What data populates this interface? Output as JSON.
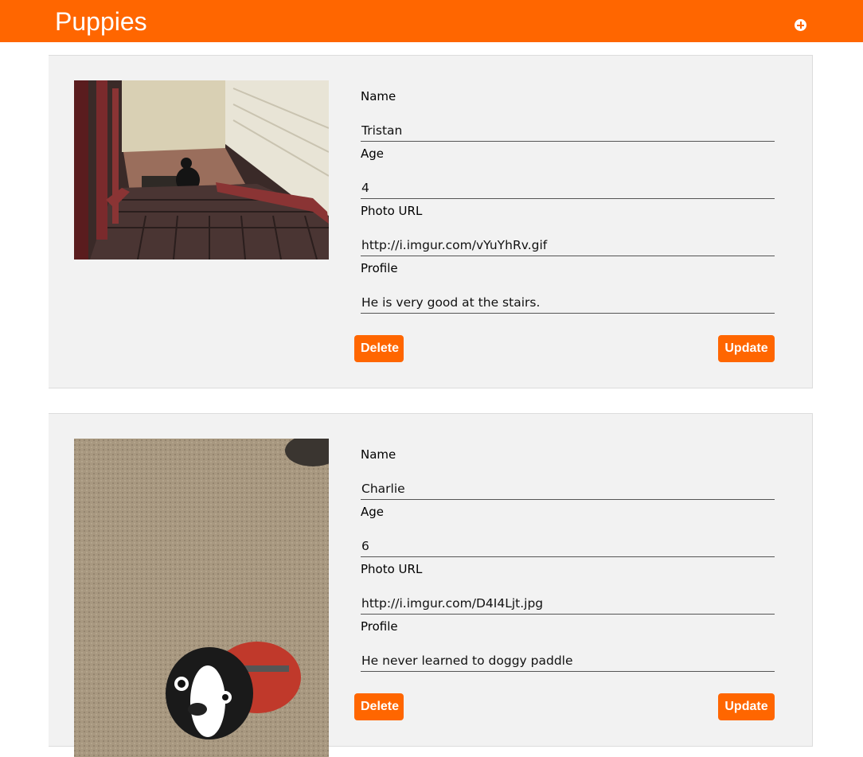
{
  "header": {
    "title": "Puppies",
    "add_icon": "plus-circle-icon"
  },
  "colors": {
    "accent": "#ff6600",
    "card_bg": "#f2f2f2"
  },
  "puppies": [
    {
      "name_label": "Name",
      "name": "Tristan",
      "age_label": "Age",
      "age": "4",
      "photo_label": "Photo URL",
      "photo_url": "http://i.imgur.com/vYuYhRv.gif",
      "profile_label": "Profile",
      "profile": "He is very good at the stairs.",
      "delete_label": "Delete",
      "update_label": "Update"
    },
    {
      "name_label": "Name",
      "name": "Charlie",
      "age_label": "Age",
      "age": "6",
      "photo_label": "Photo URL",
      "photo_url": "http://i.imgur.com/D4I4Ljt.jpg",
      "profile_label": "Profile",
      "profile": "He never learned to doggy paddle",
      "delete_label": "Delete",
      "update_label": "Update"
    }
  ]
}
